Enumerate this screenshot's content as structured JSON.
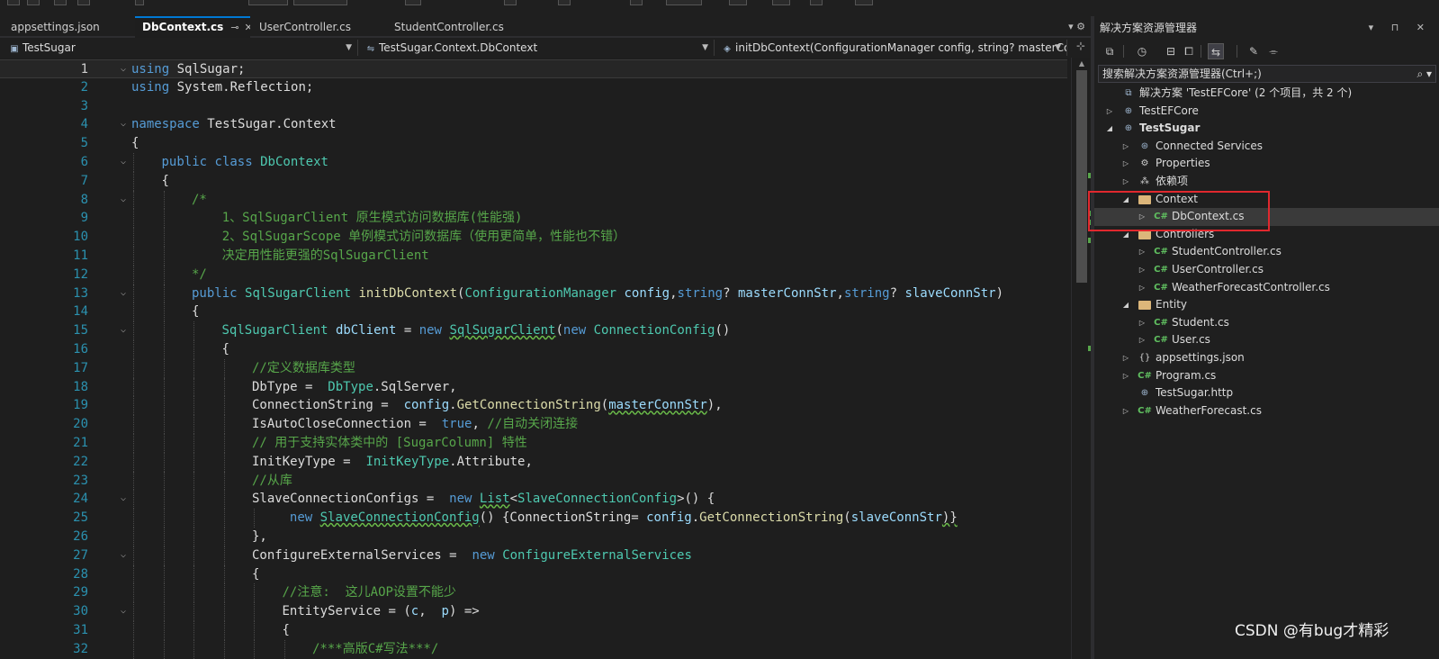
{
  "tabs": [
    {
      "label": "appsettings.json",
      "active": false
    },
    {
      "label": "DbContext.cs",
      "active": true,
      "pin": "⊸",
      "close": "✕"
    },
    {
      "label": "UserController.cs",
      "active": false
    },
    {
      "label": "StudentController.cs",
      "active": false
    }
  ],
  "tabbar_tools": "▾ ⚙",
  "navbar": {
    "project": "TestSugar",
    "type": "TestSugar.Context.DbContext",
    "member": "initDbContext(ConfigurationManager config, string? masterCo"
  },
  "code_lines": [
    {
      "n": "1",
      "f": "⌵",
      "i": 0,
      "t": [
        [
          "kw",
          "using"
        ],
        [
          "",
          "SqlSugar;"
        ]
      ]
    },
    {
      "n": "2",
      "f": "",
      "i": 0,
      "t": [
        [
          "kw",
          "using"
        ],
        [
          "",
          "System.Reflection;"
        ]
      ]
    },
    {
      "n": "3",
      "f": "",
      "i": 0,
      "t": []
    },
    {
      "n": "4",
      "f": "⌵",
      "i": 0,
      "t": [
        [
          "kw",
          "namespace"
        ],
        [
          "",
          "TestSugar.Context"
        ]
      ]
    },
    {
      "n": "5",
      "f": "",
      "i": 0,
      "t": [
        [
          "",
          "{"
        ]
      ]
    },
    {
      "n": "6",
      "f": "⌵",
      "i": 1,
      "t": [
        [
          "kw",
          "public"
        ],
        [
          "kw",
          "class"
        ],
        [
          "tp",
          "DbContext"
        ]
      ]
    },
    {
      "n": "7",
      "f": "",
      "i": 1,
      "t": [
        [
          "",
          "{"
        ]
      ]
    },
    {
      "n": "8",
      "f": "⌵",
      "i": 2,
      "t": [
        [
          "cm",
          "/*"
        ]
      ]
    },
    {
      "n": "9",
      "f": "",
      "i": 2,
      "t": [
        [
          "cm",
          "    1、SqlSugarClient 原生模式访问数据库(性能强)"
        ]
      ]
    },
    {
      "n": "10",
      "f": "",
      "i": 2,
      "t": [
        [
          "cm",
          "    2、SqlSugarScope 单例模式访问数据库（使用更简单，性能也不错）"
        ]
      ]
    },
    {
      "n": "11",
      "f": "",
      "i": 2,
      "t": [
        [
          "cm",
          "    决定用性能更强的SqlSugarClient"
        ]
      ]
    },
    {
      "n": "12",
      "f": "",
      "i": 2,
      "t": [
        [
          "cm",
          "*/"
        ]
      ]
    },
    {
      "n": "13",
      "f": "⌵",
      "i": 2,
      "t": [
        [
          "kw",
          "public"
        ],
        [
          "tp",
          "SqlSugarClient"
        ],
        [
          "mt",
          "initDbContext"
        ],
        [
          "",
          "("
        ],
        [
          "tp",
          "ConfigurationManager"
        ],
        [
          "pm",
          "config"
        ],
        [
          ",",
          ""
        ],
        [
          "kw",
          "string"
        ],
        [
          "",
          "?"
        ],
        [
          "pm",
          "masterConnStr"
        ],
        [
          ",",
          ""
        ],
        [
          "kw",
          "string"
        ],
        [
          "",
          "?"
        ],
        [
          "pm",
          "slaveConnStr"
        ],
        [
          "",
          ")"
        ]
      ]
    },
    {
      "n": "14",
      "f": "",
      "i": 2,
      "t": [
        [
          "",
          "{"
        ]
      ]
    },
    {
      "n": "15",
      "f": "⌵",
      "i": 3,
      "t": [
        [
          "tp",
          "SqlSugarClient"
        ],
        [
          "pm",
          "dbClient"
        ],
        [
          "",
          "="
        ],
        [
          "kw",
          "new"
        ],
        [
          "tp",
          "SqlSugarClient"
        ],
        [
          "",
          "("
        ],
        [
          "kw",
          "new"
        ],
        [
          "tp",
          "ConnectionConfig"
        ],
        [
          "",
          "()"
        ]
      ]
    },
    {
      "n": "16",
      "f": "",
      "i": 3,
      "t": [
        [
          "",
          "{"
        ]
      ]
    },
    {
      "n": "17",
      "f": "",
      "i": 4,
      "t": [
        [
          "cm",
          "//定义数据库类型"
        ]
      ]
    },
    {
      "n": "18",
      "f": "",
      "i": 4,
      "t": [
        [
          "",
          "DbType = "
        ],
        [
          "tp",
          "DbType"
        ],
        [
          "",
          ".SqlServer,"
        ]
      ]
    },
    {
      "n": "19",
      "f": "",
      "i": 4,
      "t": [
        [
          "",
          "ConnectionString = "
        ],
        [
          "pm",
          "config"
        ],
        [
          "",
          "."
        ],
        [
          "mt",
          "GetConnectionString"
        ],
        [
          "",
          "("
        ],
        [
          "pm",
          "masterConnStr"
        ],
        [
          "",
          "),"
        ]
      ]
    },
    {
      "n": "20",
      "f": "",
      "i": 4,
      "t": [
        [
          "",
          "IsAutoCloseConnection = "
        ],
        [
          "kw",
          "true"
        ],
        [
          "",
          ","
        ],
        [
          "cm",
          "//自动关闭连接"
        ]
      ]
    },
    {
      "n": "21",
      "f": "",
      "i": 4,
      "t": [
        [
          "cm",
          "// 用于支持实体类中的 [SugarColumn] 特性"
        ]
      ]
    },
    {
      "n": "22",
      "f": "",
      "i": 4,
      "t": [
        [
          "",
          "InitKeyType = "
        ],
        [
          "tp",
          "InitKeyType"
        ],
        [
          "",
          ".Attribute,"
        ]
      ]
    },
    {
      "n": "23",
      "f": "",
      "i": 4,
      "t": [
        [
          "cm",
          "//从库"
        ]
      ]
    },
    {
      "n": "24",
      "f": "⌵",
      "i": 4,
      "t": [
        [
          "",
          "SlaveConnectionConfigs = "
        ],
        [
          "kw",
          "new"
        ],
        [
          "tp",
          "List"
        ],
        [
          "",
          "<"
        ],
        [
          "tp",
          "SlaveConnectionConfig"
        ],
        [
          "",
          ">() {"
        ]
      ]
    },
    {
      "n": "25",
      "f": "",
      "i": 5,
      "t": [
        [
          "kw",
          " new"
        ],
        [
          "tp",
          "SlaveConnectionConfig"
        ],
        [
          "",
          "() {ConnectionString="
        ],
        [
          "pm",
          "config"
        ],
        [
          "",
          "."
        ],
        [
          "mt",
          "GetConnectionString"
        ],
        [
          "",
          "("
        ],
        [
          "pm",
          "slaveConnStr"
        ],
        [
          "",
          ")}"
        ]
      ]
    },
    {
      "n": "26",
      "f": "",
      "i": 4,
      "t": [
        [
          "",
          "},"
        ]
      ]
    },
    {
      "n": "27",
      "f": "⌵",
      "i": 4,
      "t": [
        [
          "",
          "ConfigureExternalServices = "
        ],
        [
          "kw",
          "new"
        ],
        [
          "tp",
          "ConfigureExternalServices"
        ]
      ]
    },
    {
      "n": "28",
      "f": "",
      "i": 4,
      "t": [
        [
          "",
          "{"
        ]
      ]
    },
    {
      "n": "29",
      "f": "",
      "i": 5,
      "t": [
        [
          "cm",
          "//注意:  这儿AOP设置不能少"
        ]
      ]
    },
    {
      "n": "30",
      "f": "⌵",
      "i": 5,
      "t": [
        [
          "",
          "EntityService = ("
        ],
        [
          "pm",
          "c"
        ],
        [
          "",
          ", "
        ],
        [
          "pm",
          "p"
        ],
        [
          "",
          ") =>"
        ]
      ]
    },
    {
      "n": "31",
      "f": "",
      "i": 5,
      "t": [
        [
          "",
          "{"
        ]
      ]
    },
    {
      "n": "32",
      "f": "",
      "i": 6,
      "t": [
        [
          "cm",
          "/***高版C#写法***/"
        ]
      ]
    }
  ],
  "solution": {
    "title": "解决方案资源管理器",
    "title_tools": "▾ ⊓ ✕",
    "search_placeholder": "搜索解决方案资源管理器(Ctrl+;)",
    "search_icon": "⌕ ▾",
    "toolbar_icons": [
      "vs-icon",
      "history-icon",
      "collapse-icon",
      "copy-icon",
      "sync-icon",
      "wrench-icon",
      "properties-icon"
    ],
    "tree": [
      {
        "label": "解决方案 'TestEFCore' (2 个项目，共 2 个)",
        "depth": 0,
        "arrow": "",
        "icon": "solution",
        "bold": false
      },
      {
        "label": "TestEFCore",
        "depth": 0,
        "arrow": "▷",
        "icon": "project",
        "bold": false
      },
      {
        "label": "TestSugar",
        "depth": 0,
        "arrow": "◢",
        "icon": "project",
        "bold": true
      },
      {
        "label": "Connected Services",
        "depth": 1,
        "arrow": "▷",
        "icon": "connected",
        "bold": false
      },
      {
        "label": "Properties",
        "depth": 1,
        "arrow": "▷",
        "icon": "properties",
        "bold": false
      },
      {
        "label": "依赖项",
        "depth": 1,
        "arrow": "▷",
        "icon": "deps",
        "bold": false
      },
      {
        "label": "Context",
        "depth": 1,
        "arrow": "◢",
        "icon": "folder",
        "bold": false
      },
      {
        "label": "DbContext.cs",
        "depth": 2,
        "arrow": "▷",
        "icon": "cs",
        "bold": false,
        "selected": true
      },
      {
        "label": "Controllers",
        "depth": 1,
        "arrow": "◢",
        "icon": "folder",
        "bold": false
      },
      {
        "label": "StudentController.cs",
        "depth": 2,
        "arrow": "▷",
        "icon": "cs",
        "bold": false
      },
      {
        "label": "UserController.cs",
        "depth": 2,
        "arrow": "▷",
        "icon": "cs",
        "bold": false
      },
      {
        "label": "WeatherForecastController.cs",
        "depth": 2,
        "arrow": "▷",
        "icon": "cs",
        "bold": false
      },
      {
        "label": "Entity",
        "depth": 1,
        "arrow": "◢",
        "icon": "folder",
        "bold": false
      },
      {
        "label": "Student.cs",
        "depth": 2,
        "arrow": "▷",
        "icon": "cs",
        "bold": false
      },
      {
        "label": "User.cs",
        "depth": 2,
        "arrow": "▷",
        "icon": "cs",
        "bold": false
      },
      {
        "label": "appsettings.json",
        "depth": 1,
        "arrow": "▷",
        "icon": "json",
        "bold": false
      },
      {
        "label": "Program.cs",
        "depth": 1,
        "arrow": "▷",
        "icon": "cs",
        "bold": false
      },
      {
        "label": "TestSugar.http",
        "depth": 1,
        "arrow": "",
        "icon": "http",
        "bold": false
      },
      {
        "label": "WeatherForecast.cs",
        "depth": 1,
        "arrow": "▷",
        "icon": "cs",
        "bold": false
      }
    ]
  },
  "watermark": "CSDN @有bug才精彩",
  "colors": {
    "accent": "#0078d4",
    "highlight_box": "#e0282e",
    "keyword": "#569cd6",
    "type": "#4ec9b0",
    "comment": "#57a64a",
    "method": "#dcdcaa",
    "param": "#9cdcfe"
  }
}
